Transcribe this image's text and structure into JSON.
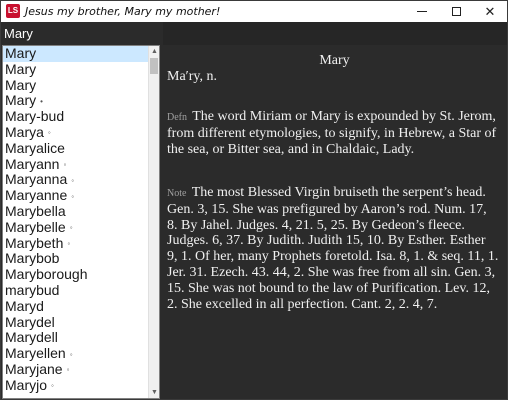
{
  "window": {
    "title": "Jesus my brother, Mary my mother!",
    "icon_text": "LS"
  },
  "search": {
    "value": "Mary"
  },
  "word_list": {
    "items": [
      {
        "label": "Mary",
        "marker": "",
        "selected": true
      },
      {
        "label": "Mary",
        "marker": ""
      },
      {
        "label": "Mary",
        "marker": ""
      },
      {
        "label": "Mary",
        "marker": "•"
      },
      {
        "label": "Mary-bud",
        "marker": ""
      },
      {
        "label": "Marya",
        "marker": "◦"
      },
      {
        "label": "Maryalice",
        "marker": ""
      },
      {
        "label": "Maryann",
        "marker": "◦"
      },
      {
        "label": "Maryanna",
        "marker": "◦"
      },
      {
        "label": "Maryanne",
        "marker": "◦"
      },
      {
        "label": "Marybella",
        "marker": ""
      },
      {
        "label": "Marybelle",
        "marker": "◦"
      },
      {
        "label": "Marybeth",
        "marker": "◦"
      },
      {
        "label": "Marybob",
        "marker": ""
      },
      {
        "label": "Maryborough",
        "marker": ""
      },
      {
        "label": "marybud",
        "marker": ""
      },
      {
        "label": "Maryd",
        "marker": ""
      },
      {
        "label": "Marydel",
        "marker": ""
      },
      {
        "label": "Marydell",
        "marker": ""
      },
      {
        "label": "Maryellen",
        "marker": "◦"
      },
      {
        "label": "Maryjane",
        "marker": "◦"
      },
      {
        "label": "Maryjo",
        "marker": "◦"
      }
    ]
  },
  "entry": {
    "headword": "Mary",
    "pronunciation": "Ma′ry, n.",
    "definition_tag": "Defn",
    "definition": "The word Miriam or Mary is expounded by St. Jerom, from different etymologies, to signify, in Hebrew, a Star of the sea, or Bitter sea, and in Chaldaic, Lady.",
    "note_tag": "Note",
    "note": "The most Blessed Virgin bruiseth the serpent’s head. Gen. 3, 15. She was prefigured by Aaron’s rod. Num. 17, 8. By Jahel. Judges. 4, 21. 5, 25. By Gedeon’s fleece. Judges. 6, 37. By Judith. Judith 15, 10. By Esther. Esther 9, 1. Of her, many Prophets foretold. Isa. 8, 1. & seq. 11, 1. Jer. 31. Ezech. 43. 44, 2. She was free from all sin. Gen. 3, 15. She was not bound to the law of Purification. Lev. 12, 2. She excelled in all perfection. Cant. 2, 2. 4, 7."
  },
  "icons": {
    "minimize": "minimize-icon",
    "maximize": "maximize-icon",
    "close": "close-icon",
    "scroll_up": "scroll-up-arrow-icon",
    "scroll_down": "scroll-down-arrow-icon"
  },
  "colors": {
    "app_icon": "#c8102e",
    "selection": "#cce8ff",
    "content_bg": "#2b2b2b"
  }
}
